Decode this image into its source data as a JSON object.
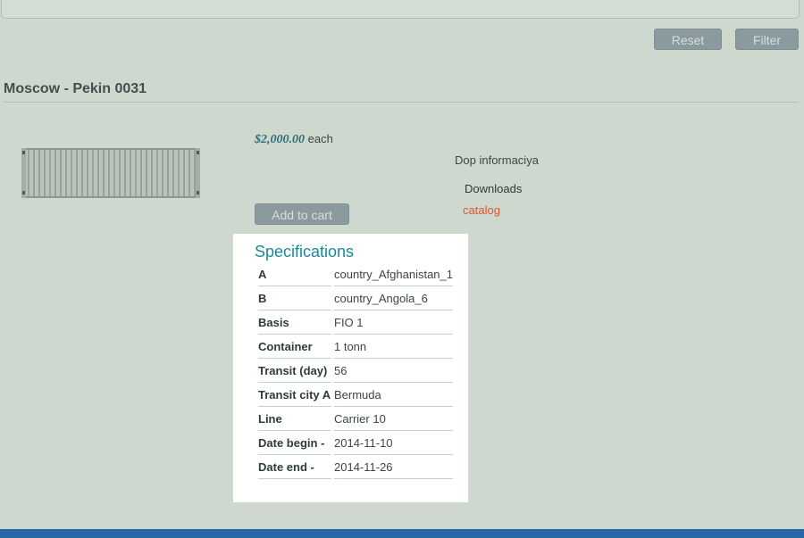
{
  "filter": {
    "reset_label": "Reset",
    "filter_label": "Filter"
  },
  "product": {
    "title": "Moscow - Pekin 0031",
    "image_icon": "shipping-container-image",
    "price": "$2,000.00",
    "price_unit": "each",
    "add_to_cart_label": "Add to cart",
    "extra_info_label": "Dop informaciya",
    "downloads_label": "Downloads",
    "catalog_link": "catalog"
  },
  "specifications": {
    "heading": "Specifications",
    "rows": [
      {
        "name": "A",
        "value": "country_Afghanistan_1"
      },
      {
        "name": "B",
        "value": "country_Angola_6"
      },
      {
        "name": "Basis",
        "value": "FIO 1"
      },
      {
        "name": "Container",
        "value": "1 tonn"
      },
      {
        "name": "Transit (day)",
        "value": "56"
      },
      {
        "name": "Transit city A",
        "value": "Bermuda"
      },
      {
        "name": "Line",
        "value": "Carrier 10"
      },
      {
        "name": "Date begin -",
        "value": "2014-11-10"
      },
      {
        "name": "Date end -",
        "value": "2014-11-26"
      }
    ]
  },
  "colors": {
    "background": "#cfd8cf",
    "button": "#8a9a9e",
    "accent_price": "#2d7078",
    "heading": "#1a8a9a",
    "link": "#e2542c",
    "footer_bar": "#2b67a6"
  }
}
